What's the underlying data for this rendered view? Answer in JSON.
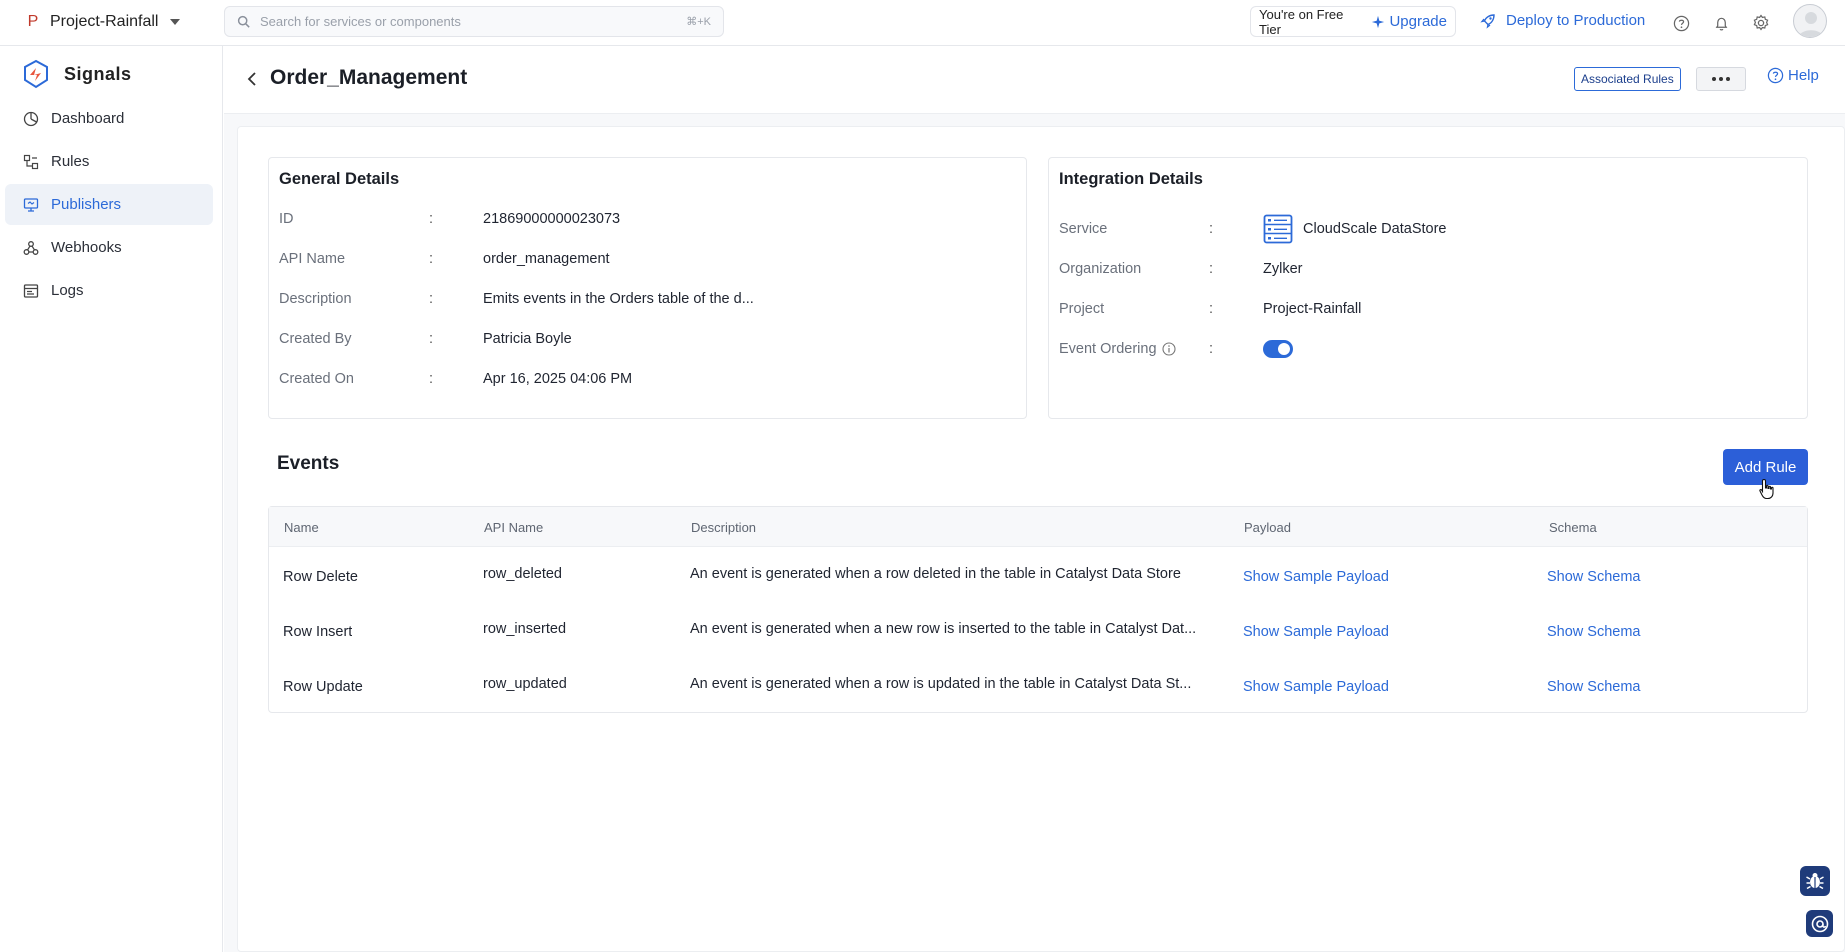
{
  "topbar": {
    "project_initial": "P",
    "project_name": "Project-Rainfall",
    "search_placeholder": "Search for services or components",
    "search_shortcut": "⌘+K",
    "tier_text": "You're on Free Tier",
    "upgrade_label": "Upgrade",
    "deploy_label": "Deploy to Production"
  },
  "sidebar": {
    "brand": "Signals",
    "items": [
      {
        "label": "Dashboard",
        "icon": "dashboard-icon"
      },
      {
        "label": "Rules",
        "icon": "rules-icon"
      },
      {
        "label": "Publishers",
        "icon": "publishers-icon",
        "active": true
      },
      {
        "label": "Webhooks",
        "icon": "webhooks-icon"
      },
      {
        "label": "Logs",
        "icon": "logs-icon"
      }
    ]
  },
  "header": {
    "title": "Order_Management",
    "associated_rules_label": "Associated Rules",
    "help_label": "Help"
  },
  "general": {
    "title": "General Details",
    "rows": [
      {
        "key": "ID",
        "value": "21869000000023073"
      },
      {
        "key": "API Name",
        "value": "order_management"
      },
      {
        "key": "Description",
        "value": "Emits events in the Orders table of the d..."
      },
      {
        "key": "Created By",
        "value": "Patricia Boyle"
      },
      {
        "key": "Created On",
        "value": "Apr 16, 2025 04:06 PM"
      }
    ],
    "separator": ":"
  },
  "integration": {
    "title": "Integration Details",
    "rows": [
      {
        "key": "Service",
        "value": "CloudScale DataStore"
      },
      {
        "key": "Organization",
        "value": "Zylker"
      },
      {
        "key": "Project",
        "value": "Project-Rainfall"
      },
      {
        "key": "Event Ordering",
        "value": ""
      }
    ],
    "event_ordering_enabled": true
  },
  "events": {
    "title": "Events",
    "add_rule_label": "Add Rule",
    "columns": [
      "Name",
      "API Name",
      "Description",
      "Payload",
      "Schema"
    ],
    "rows": [
      {
        "name": "Row Delete",
        "api_name": "row_deleted",
        "description": "An event is generated when a row deleted in the table in Catalyst Data Store",
        "payload": "Show Sample Payload",
        "schema": "Show Schema"
      },
      {
        "name": "Row Insert",
        "api_name": "row_inserted",
        "description": "An event is generated when a new row is inserted to the table in Catalyst Dat...",
        "payload": "Show Sample Payload",
        "schema": "Show Schema"
      },
      {
        "name": "Row Update",
        "api_name": "row_updated",
        "description": "An event is generated when a row is updated in the table in Catalyst Data St...",
        "payload": "Show Sample Payload",
        "schema": "Show Schema"
      }
    ]
  },
  "colors": {
    "accent": "#2c6ad8",
    "primary_button": "#2c5fd8",
    "active_nav_bg": "#eef2f8"
  }
}
